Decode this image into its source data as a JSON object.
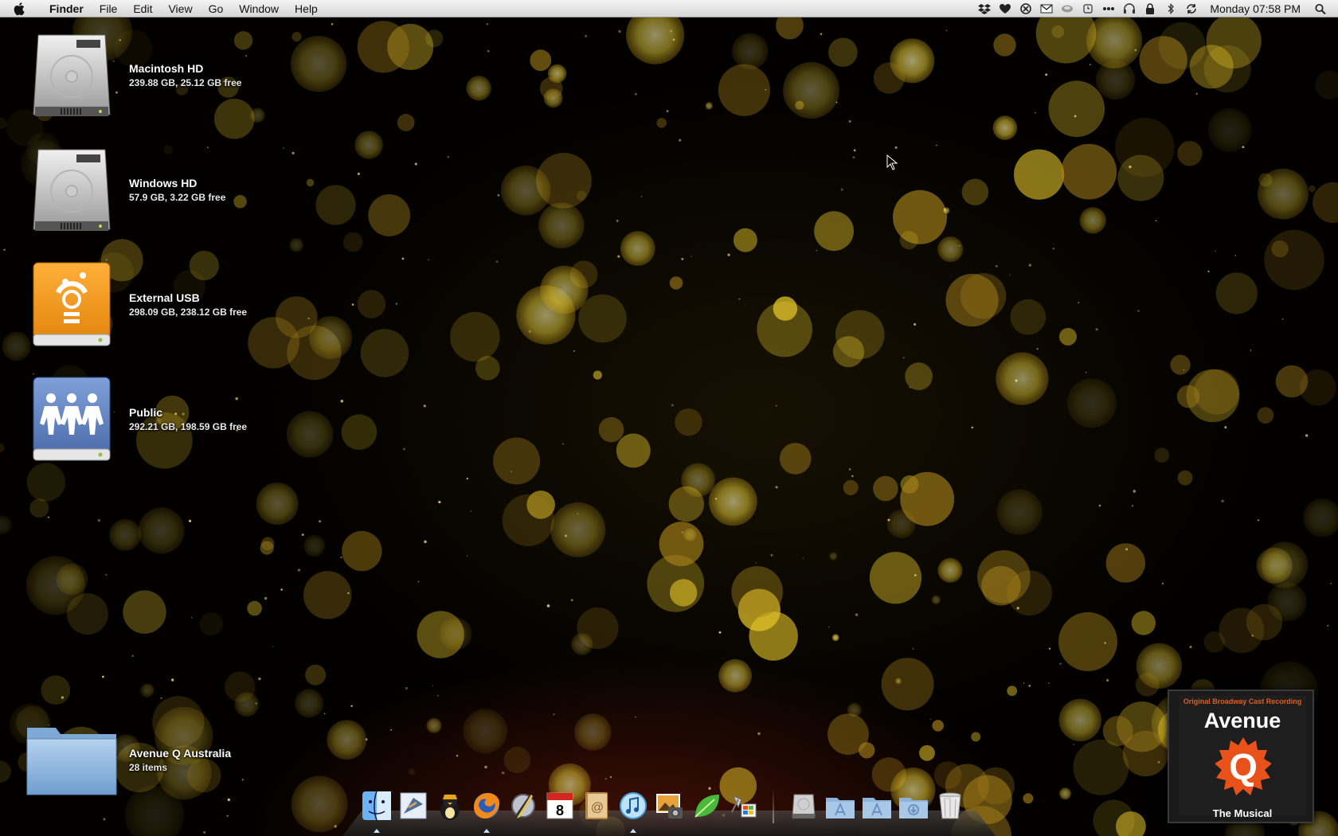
{
  "menubar": {
    "apple_icon": "apple-icon",
    "app_name": "Finder",
    "menus": [
      "File",
      "Edit",
      "View",
      "Go",
      "Window",
      "Help"
    ],
    "status_icons": [
      "dropbox-icon",
      "heart-icon",
      "xmarks-icon",
      "gmail-icon",
      "growl-icon",
      "alarm-icon",
      "dots-icon",
      "headphones-icon",
      "lock-icon",
      "bluetooth-icon",
      "sync-icon"
    ],
    "clock": "Monday 07:58 PM",
    "search_icon": "spotlight-icon"
  },
  "desktop": {
    "items": [
      {
        "name": "Macintosh HD",
        "detail": "239.88 GB, 25.12 GB free",
        "icon": "hard-drive-icon"
      },
      {
        "name": "Windows HD",
        "detail": "57.9 GB, 3.22 GB free",
        "icon": "hard-drive-icon"
      },
      {
        "name": "External USB",
        "detail": "298.09 GB, 238.12 GB free",
        "icon": "firewire-drive-icon"
      },
      {
        "name": "Public",
        "detail": "292.21 GB, 198.59 GB free",
        "icon": "network-share-icon"
      },
      {
        "name": "Avenue Q Australia",
        "detail": "28 items",
        "icon": "folder-icon"
      }
    ]
  },
  "album_art": {
    "top_text": "Original Broadway Cast Recording",
    "title": "Avenue",
    "letter": "Q",
    "subtitle": "The Musical"
  },
  "dock": {
    "apps": [
      "finder-icon",
      "mail-icon",
      "adium-icon",
      "firefox-icon",
      "script-editor-icon",
      "ical-icon",
      "address-book-icon",
      "itunes-icon",
      "iphoto-icon",
      "leaf-icon",
      "parallels-icon"
    ],
    "calendar_day": "8",
    "right_items": [
      "disk-icon",
      "applications-folder-icon",
      "documents-folder-icon",
      "downloads-folder-icon",
      "trash-icon"
    ]
  },
  "colors": {
    "firewire_orange": "#f49a1c",
    "share_blue": "#5a7cb8",
    "bokeh_gold": "#f7e34a"
  }
}
